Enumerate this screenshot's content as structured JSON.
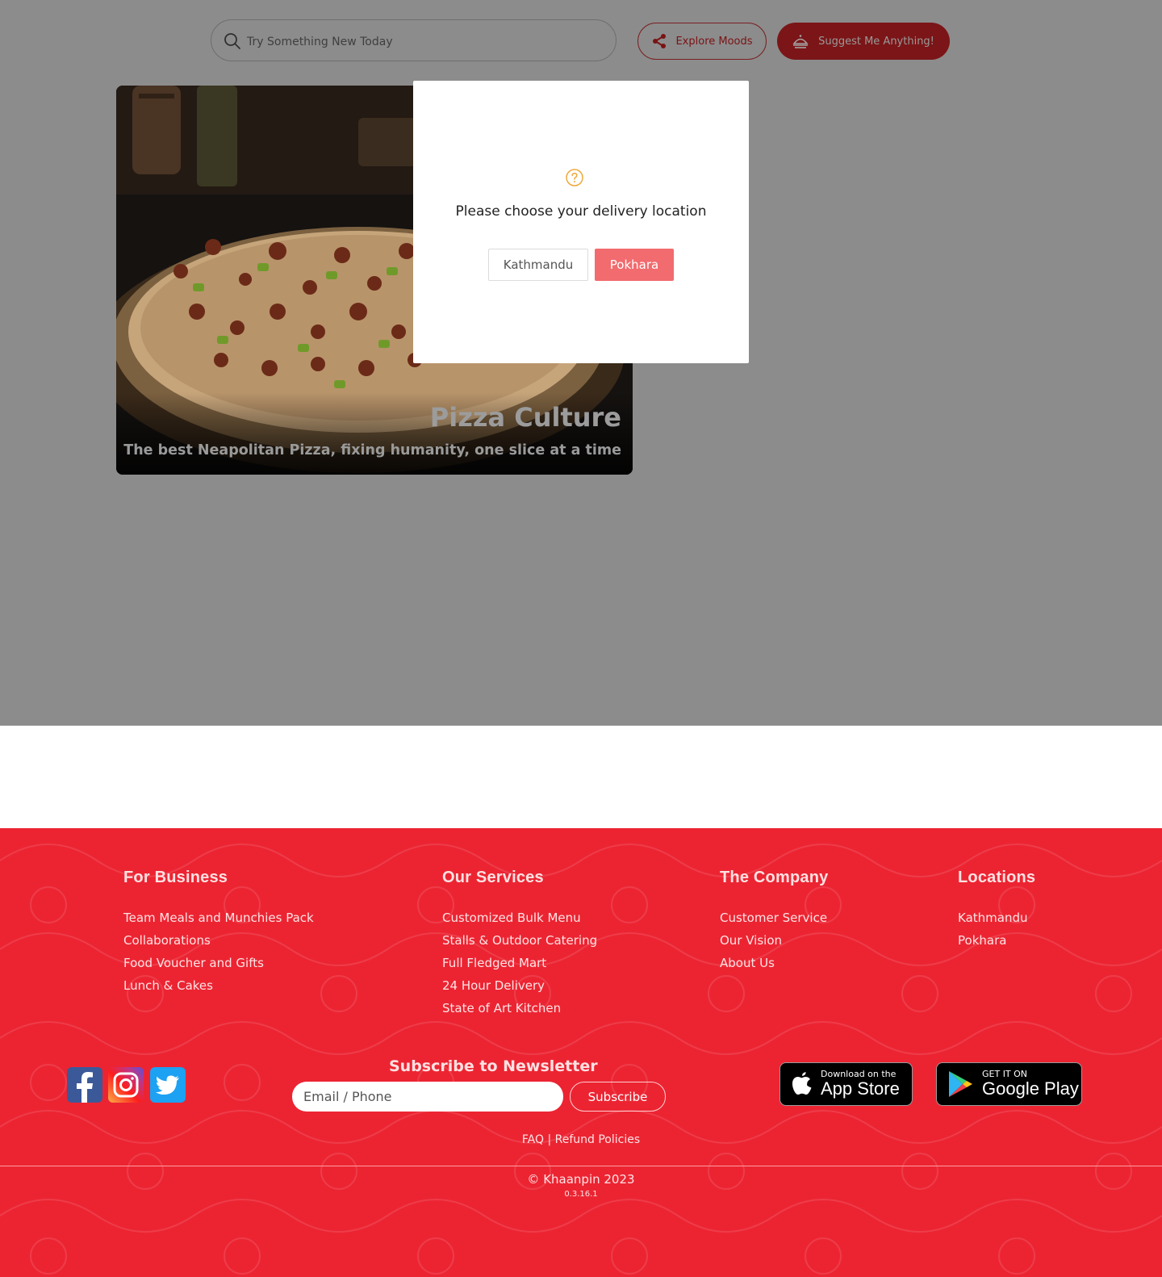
{
  "header": {
    "search_placeholder": "Try Something New Today",
    "explore_label": "Explore Moods",
    "suggest_label": "Suggest Me Anything!"
  },
  "hero": {
    "title": "Pizza Culture",
    "subtitle": "The best Neapolitan Pizza, fixing humanity, one slice at a time"
  },
  "modal": {
    "icon": "question-circle-icon",
    "message": "Please choose your delivery location",
    "options": [
      "Kathmandu",
      "Pokhara"
    ]
  },
  "footer": {
    "columns": [
      {
        "title": "For Business",
        "items": [
          "Team Meals and Munchies Pack",
          "Collaborations",
          "Food Voucher and Gifts",
          "Lunch & Cakes"
        ]
      },
      {
        "title": "Our Services",
        "items": [
          "Customized Bulk Menu",
          "Stalls & Outdoor Catering",
          "Full Fledged Mart",
          "24 Hour Delivery",
          "State of Art Kitchen"
        ]
      },
      {
        "title": "The Company",
        "items": [
          "Customer Service",
          "Our Vision",
          "About Us"
        ]
      },
      {
        "title": "Locations",
        "items": [
          "Kathmandu",
          "Pokhara"
        ]
      }
    ],
    "newsletter": {
      "title": "Subscribe to Newsletter",
      "placeholder": "Email / Phone",
      "button": "Subscribe"
    },
    "app_store": {
      "small": "Download on the",
      "large": "App Store"
    },
    "google_play": {
      "small": "GET IT ON",
      "large": "Google Play"
    },
    "faq": "FAQ",
    "separator": "|",
    "refund": "Refund Policies",
    "copyright": "© Khaanpin 2023",
    "version": "0.3.16.1"
  },
  "colors": {
    "brand_red": "#ec2432",
    "modal_accent": "#f26b6e",
    "overlay_gray": "#8c8c8c"
  }
}
